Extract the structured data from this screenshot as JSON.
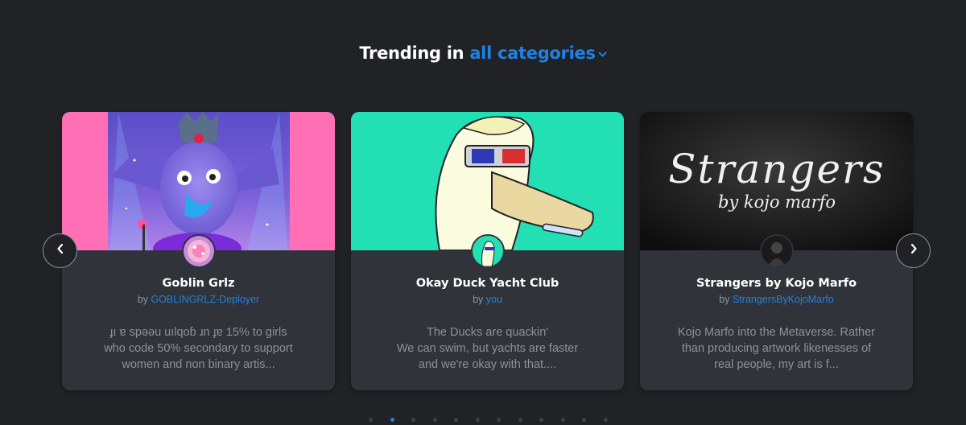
{
  "heading": {
    "prefix": "Trending in",
    "category": "all categories"
  },
  "cards": [
    {
      "title": "Goblin Grlz",
      "by_label": "by",
      "creator": "GOBLINGRLZ-Deployer",
      "desc_lines": [
        "ɟı ɐ spəəu uılqoɓ ɹn ɟɐ 15% to girls",
        "who code 50% secondary to support",
        "women and non binary artis..."
      ]
    },
    {
      "title": "Okay Duck Yacht Club",
      "by_label": "by",
      "creator": "you",
      "desc_lines": [
        "The Ducks are quackin'",
        "We can swim, but yachts are faster",
        "and we're okay with that...."
      ]
    },
    {
      "title": "Strangers by Kojo Marfo",
      "by_label": "by",
      "creator": "StrangersByKojoMarfo",
      "banner_title": "Strangers",
      "banner_sub": "by kojo marfo",
      "desc_lines": [
        "Kojo Marfo into the Metaverse. Rather",
        "than producing artwork likenesses of",
        "real people, my art is f..."
      ]
    }
  ],
  "pagination": {
    "count": 12,
    "active_index": 1
  },
  "icons": {
    "prev": "chevron-left-icon",
    "next": "chevron-right-icon",
    "category_dropdown": "chevron-down-icon"
  },
  "colors": {
    "background": "#202225",
    "card": "#303339",
    "accent": "#2081e2",
    "muted_text": "#8a939b"
  }
}
